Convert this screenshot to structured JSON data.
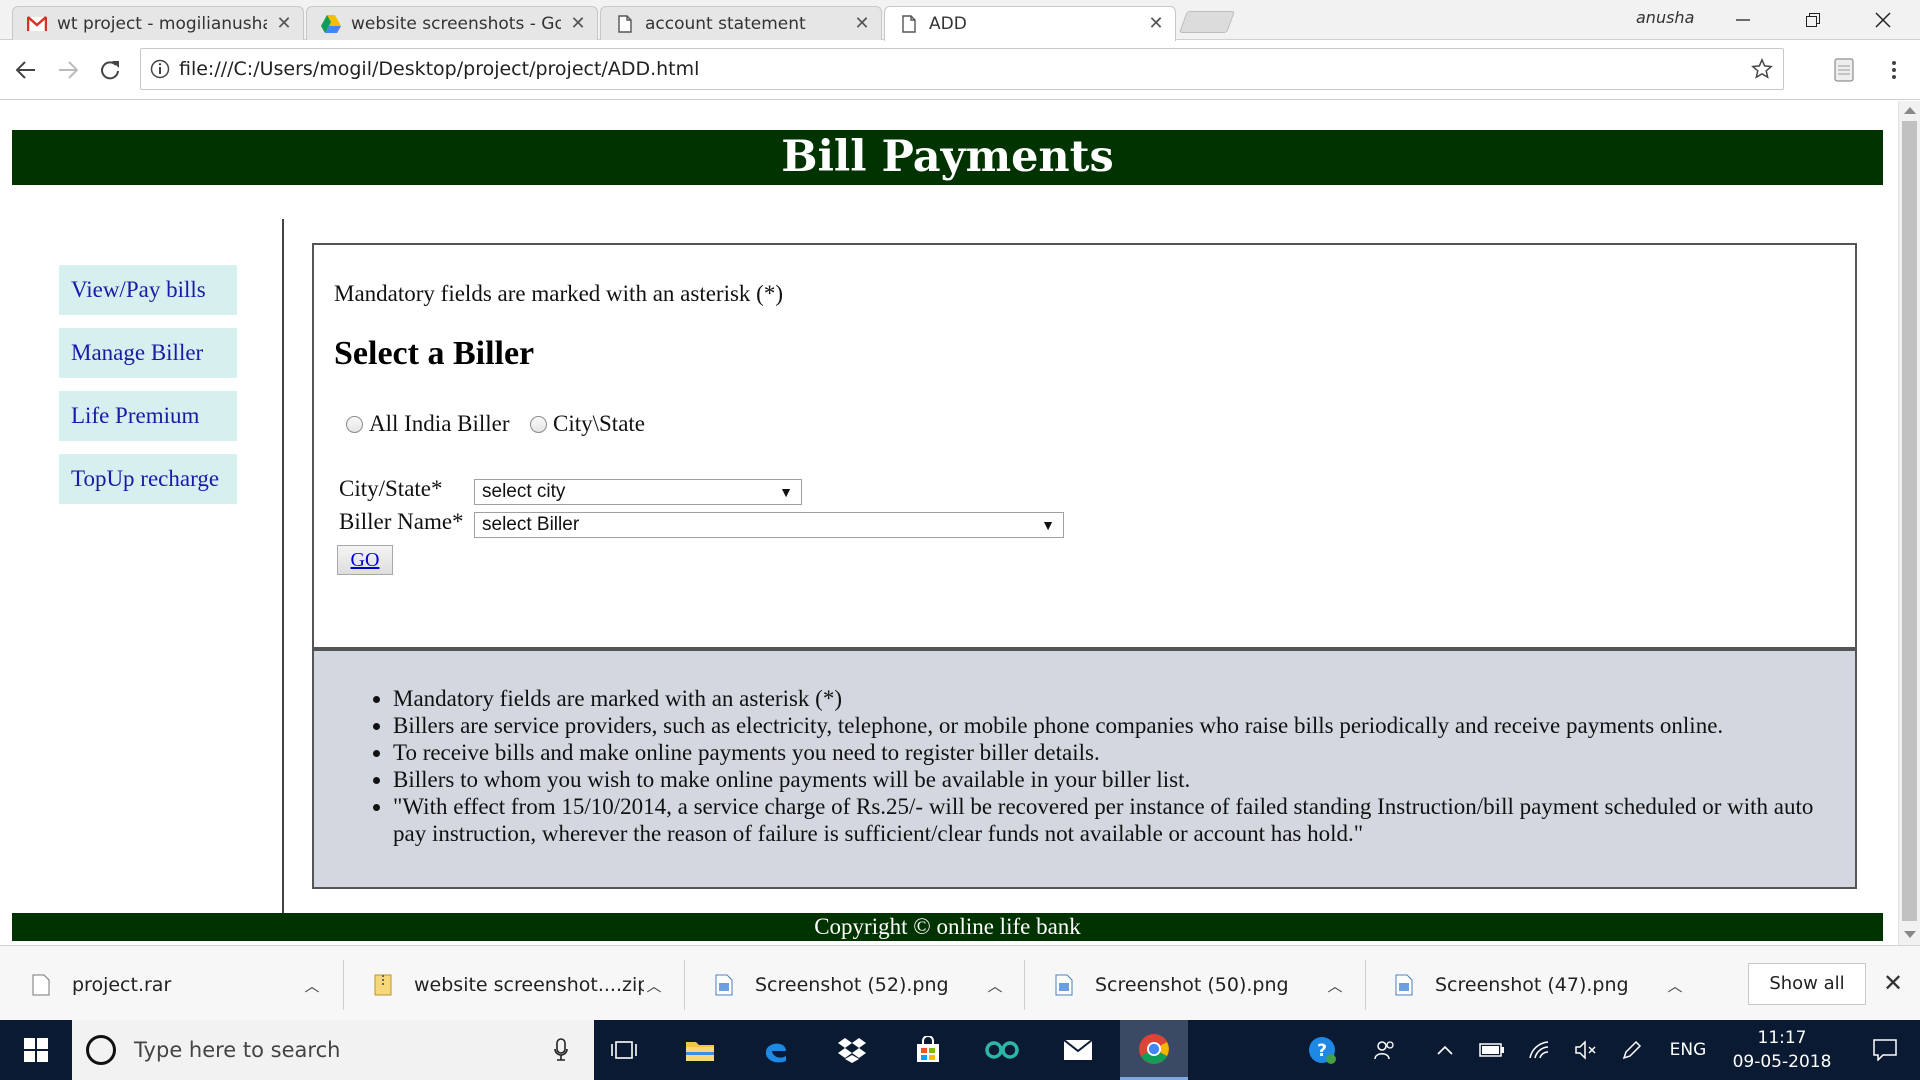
{
  "browser": {
    "tabs": [
      {
        "title": "wt project - mogilianusha",
        "icon": "gmail-icon"
      },
      {
        "title": "website screenshots - Go",
        "icon": "google-drive-icon"
      },
      {
        "title": "account statement",
        "icon": "document-icon"
      },
      {
        "title": "ADD",
        "icon": "document-icon",
        "active": true
      }
    ],
    "profile_name": "anusha",
    "url": "file:///C:/Users/mogil/Desktop/project/project/ADD.html"
  },
  "page": {
    "banner_title": "Bill Payments",
    "sidebar": {
      "items": [
        {
          "label": "View/Pay bills"
        },
        {
          "label": "Manage Biller"
        },
        {
          "label": "Life Premium"
        },
        {
          "label": "TopUp recharge"
        }
      ]
    },
    "form": {
      "mandatory_note": "Mandatory fields are marked with an asterisk (*)",
      "heading": "Select a Biller",
      "radio_options": [
        "All India Biller",
        "City\\State"
      ],
      "city_label": "City/State*",
      "city_select_value": "select city",
      "biller_label": "Biller Name*",
      "biller_select_value": "select Biller",
      "go_label": "GO"
    },
    "info": {
      "bullets": [
        "Mandatory fields are marked with an asterisk (*)",
        "Billers are service providers, such as electricity, telephone, or mobile phone companies who raise bills periodically and receive payments online.",
        "To receive bills and make online payments you need to register biller details.",
        "Billers to whom you wish to make online payments will be available in your biller list.",
        "\"With effect from 15/10/2014, a service charge of Rs.25/- will be recovered per instance of failed standing Instruction/bill payment scheduled or with auto pay instruction, wherever the reason of failure is sufficient/clear funds not available or account has hold.\""
      ]
    },
    "footer": "Copyright © online life bank"
  },
  "downloads": {
    "items": [
      {
        "name": "project.rar",
        "icon": "file-icon"
      },
      {
        "name": "website screenshot....zip",
        "icon": "zip-icon"
      },
      {
        "name": "Screenshot (52).png",
        "icon": "image-icon"
      },
      {
        "name": "Screenshot (50).png",
        "icon": "image-icon"
      },
      {
        "name": "Screenshot (47).png",
        "icon": "image-icon"
      }
    ],
    "show_all_label": "Show all"
  },
  "taskbar": {
    "search_placeholder": "Type here to search",
    "language": "ENG",
    "time": "11:17",
    "date": "09-05-2018"
  },
  "colors": {
    "banner_bg": "#003300",
    "sidebar_link_bg": "#d6f0f0",
    "info_box_bg": "#d3d8e0",
    "taskbar_bg": "#0b1a33"
  }
}
